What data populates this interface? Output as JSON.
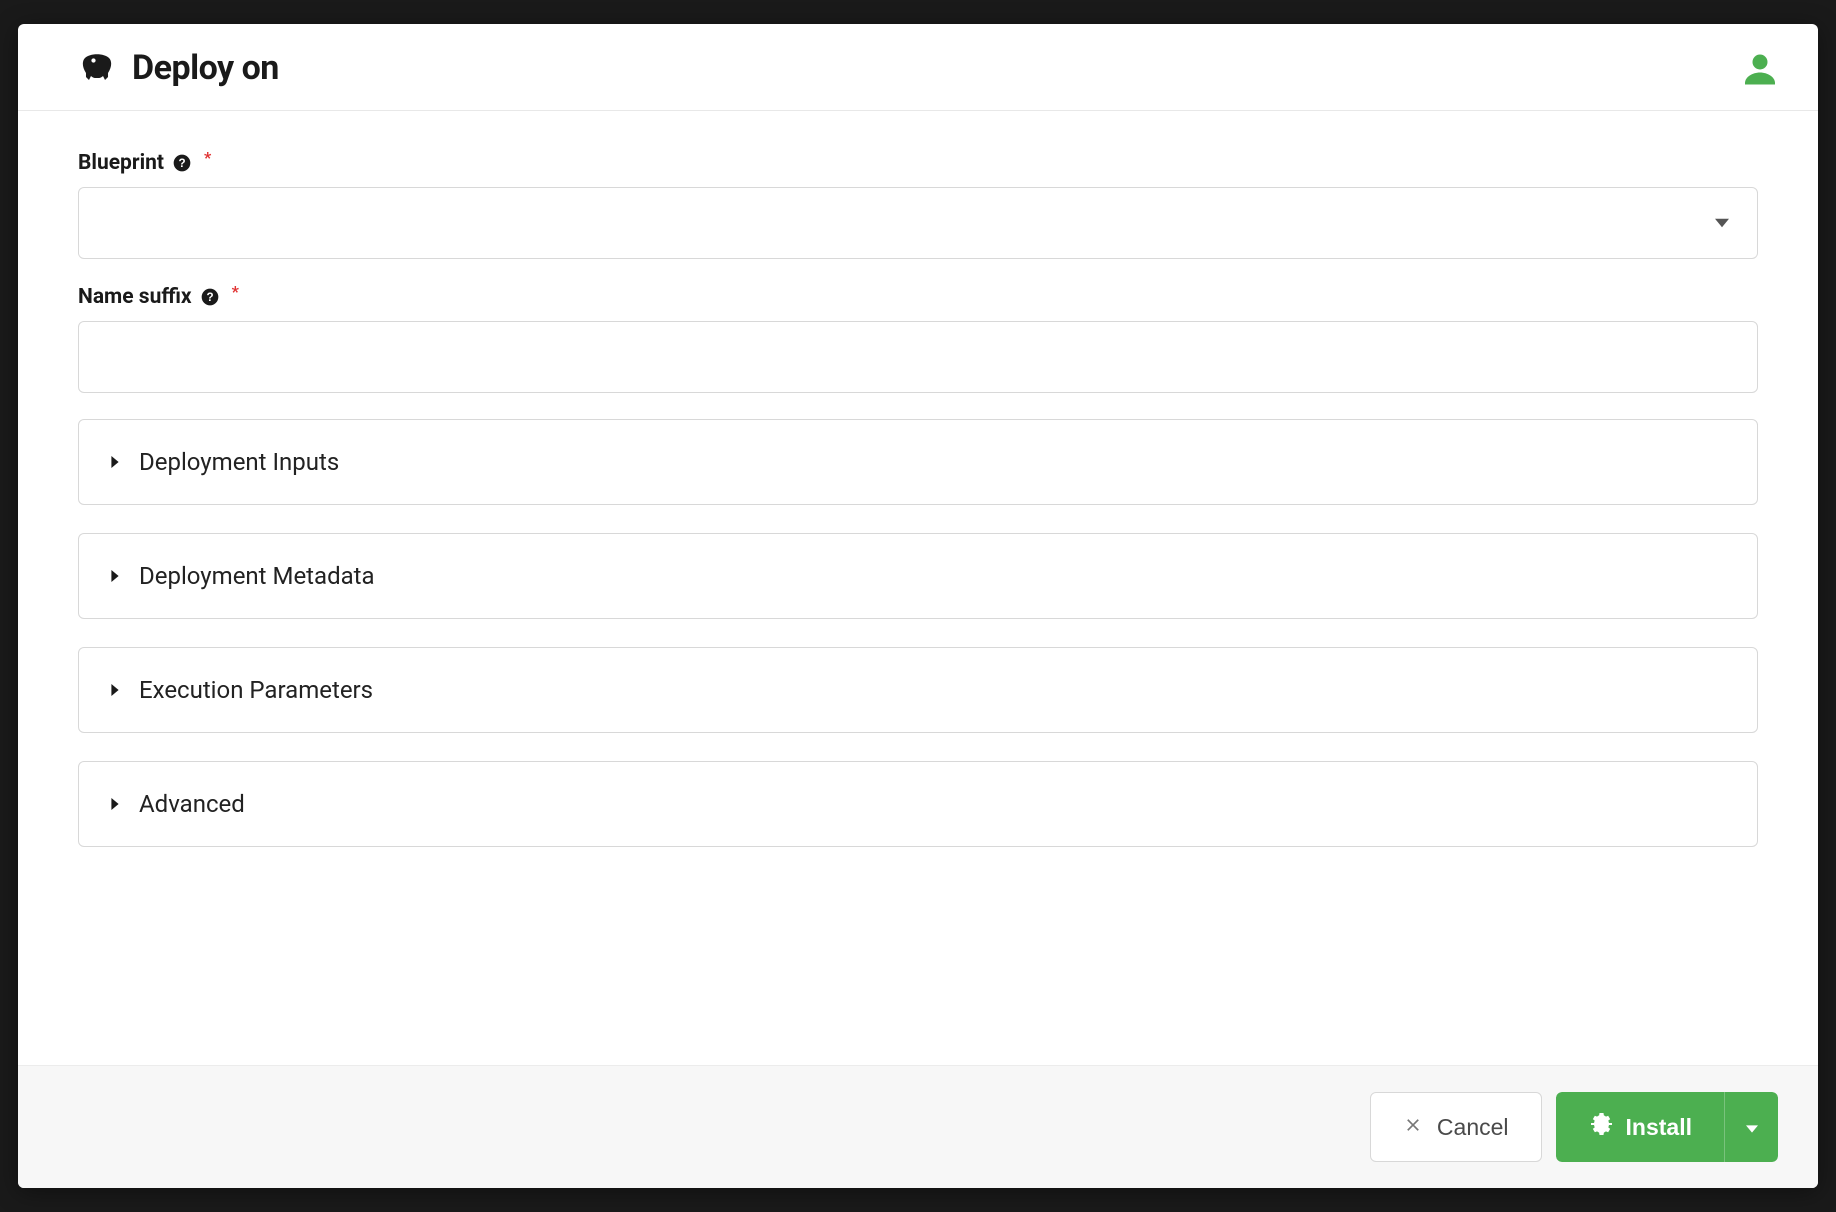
{
  "modal": {
    "title": "Deploy on"
  },
  "fields": {
    "blueprint": {
      "label": "Blueprint",
      "value": ""
    },
    "name_suffix": {
      "label": "Name suffix",
      "value": ""
    }
  },
  "accordions": [
    {
      "title": "Deployment Inputs"
    },
    {
      "title": "Deployment Metadata"
    },
    {
      "title": "Execution Parameters"
    },
    {
      "title": "Advanced"
    }
  ],
  "footer": {
    "cancel_label": "Cancel",
    "install_label": "Install"
  },
  "colors": {
    "primary_green": "#4caf50",
    "text_dark": "#1a1a1a",
    "border_gray": "#d8d8d8",
    "required_red": "#e03131"
  }
}
